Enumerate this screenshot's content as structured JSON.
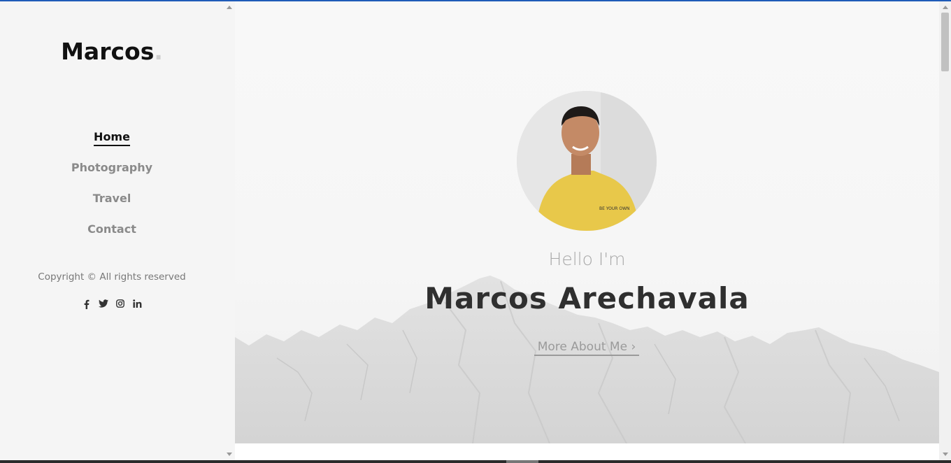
{
  "sidebar": {
    "brand": "Marcos",
    "brand_dot": ".",
    "nav": [
      {
        "label": "Home",
        "active": true
      },
      {
        "label": "Photography",
        "active": false
      },
      {
        "label": "Travel",
        "active": false
      },
      {
        "label": "Contact",
        "active": false
      }
    ],
    "copyright": "Copyright © All rights reserved",
    "social": [
      {
        "icon": "facebook-icon",
        "glyph": "f"
      },
      {
        "icon": "twitter-icon",
        "glyph": "🐦"
      },
      {
        "icon": "instagram-icon",
        "glyph": "◎"
      },
      {
        "icon": "linkedin-icon",
        "glyph": "in"
      }
    ]
  },
  "hero": {
    "greeting": "Hello I'm",
    "name": "Marcos Arechavala",
    "more_link": "More About Me ›"
  },
  "colors": {
    "accent_top": "#1e5bb8",
    "text_dark": "#2f2f2f",
    "nav_inactive": "#8a8a8a"
  }
}
